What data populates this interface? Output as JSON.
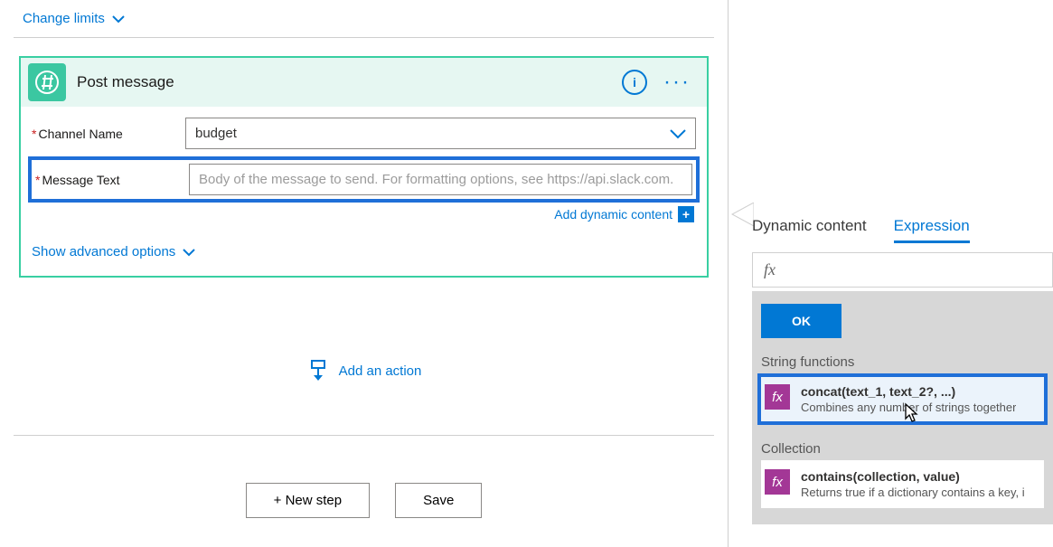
{
  "top_link": {
    "label": "Change limits"
  },
  "card": {
    "title": "Post message",
    "fields": {
      "channel_label": "Channel Name",
      "channel_value": "budget",
      "message_label": "Message Text",
      "message_placeholder": "Body of the message to send. For formatting options, see https://api.slack.com."
    },
    "dyn_link": "Add dynamic content",
    "adv_link": "Show advanced options"
  },
  "add_action": "Add an action",
  "buttons": {
    "new_step": "+ New step",
    "save": "Save"
  },
  "panel": {
    "tab_dynamic": "Dynamic content",
    "tab_expression": "Expression",
    "fx_prefix": "fx",
    "ok": "OK",
    "cat_string": "String functions",
    "func_concat_name": "concat(text_1, text_2?, ...)",
    "func_concat_desc": "Combines any number of strings together",
    "cat_collection": "Collection",
    "func_contains_name": "contains(collection, value)",
    "func_contains_desc": "Returns true if a dictionary contains a key, i"
  }
}
